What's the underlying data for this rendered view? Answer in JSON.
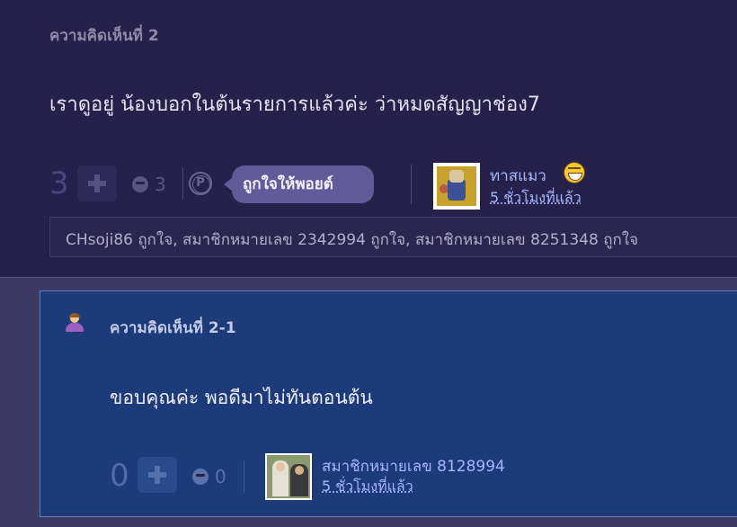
{
  "comment": {
    "number_label": "ความคิดเห็นที่ 2",
    "body": "เราดูอยู่ น้องบอกในต้นรายการแล้วค่ะ ว่าหมดสัญญาช่อง7",
    "vote_count": "3",
    "emoji_count": "3",
    "tooltip": "ถูกใจให้พอยต์",
    "point_icon_glyph": "P",
    "author": "ทาสแมว",
    "time": "5 ชั่วโมงที่แล้ว",
    "likes": "CHsoji86 ถูกใจ, สมาชิกหมายเลข 2342994 ถูกใจ, สมาชิกหมายเลข 8251348 ถูกใจ"
  },
  "reply": {
    "number_label": "ความคิดเห็นที่ 2-1",
    "body": "ขอบคุณค่ะ พอดีมาไม่ทันตอนต้น",
    "vote_count": "0",
    "emoji_count": "0",
    "author": "สมาชิกหมายเลข 8128994",
    "time": "5 ชั่วโมงที่แล้ว"
  },
  "colors": {
    "comment_bg": "#25214a",
    "reply_bg": "#1d3a79",
    "link": "#a7b6ff",
    "tooltip_bg": "#625b99"
  }
}
